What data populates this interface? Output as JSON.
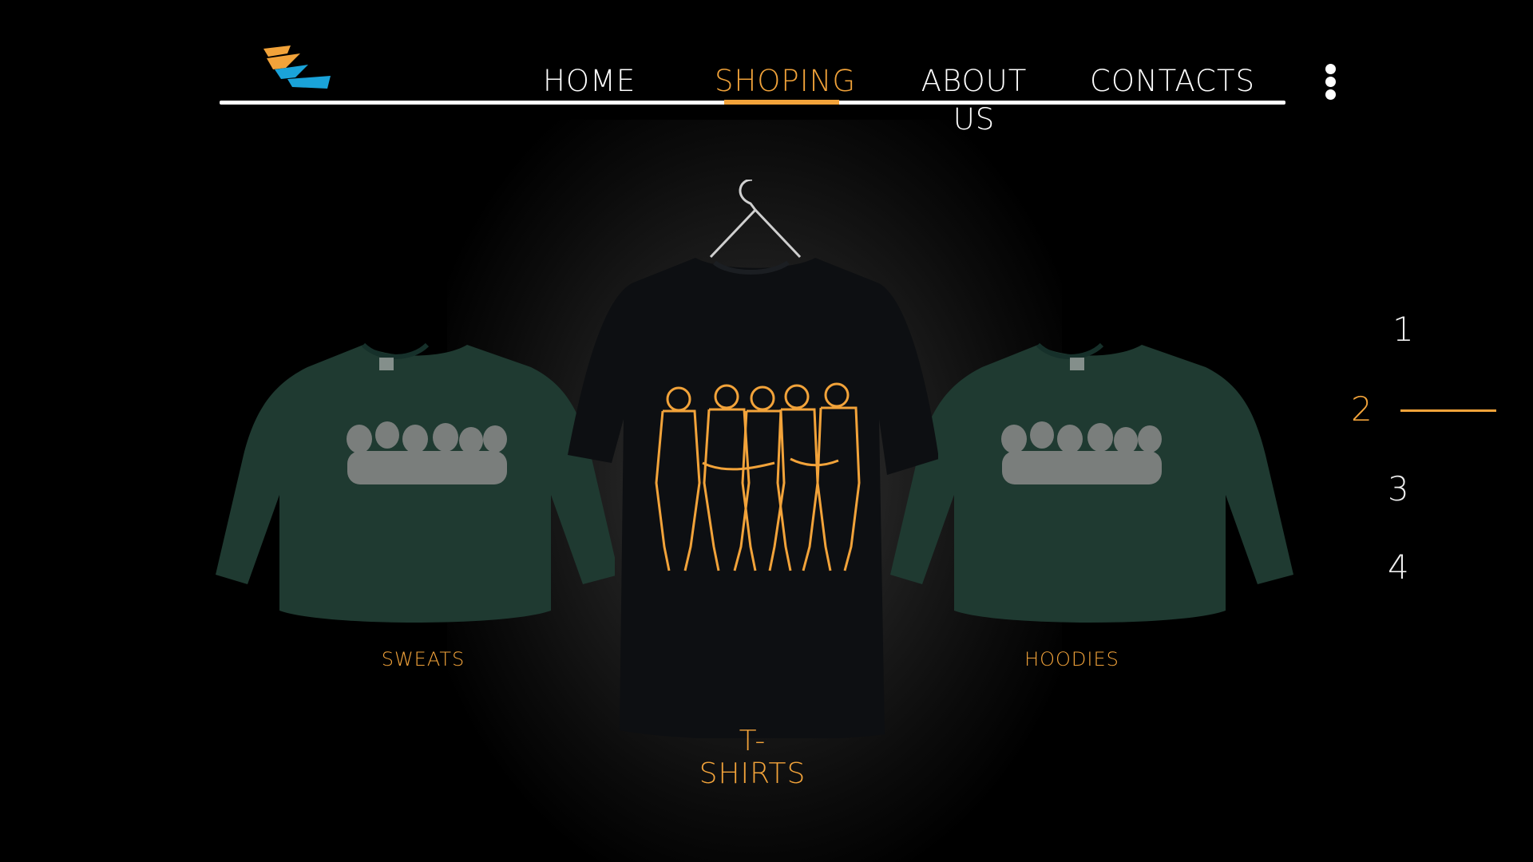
{
  "brand": {
    "logo_icon": "zigzag-logo-icon",
    "colors": {
      "orange": "#f2a33a",
      "blue": "#1aa3d9"
    }
  },
  "nav": {
    "items": [
      {
        "label": "HOME"
      },
      {
        "label": "SHOPING",
        "active": true
      },
      {
        "label": "ABOUT US"
      },
      {
        "label": "CONTACTS"
      }
    ],
    "menu_icon": "more-vertical-icon"
  },
  "products": {
    "left": {
      "label": "SWEATS",
      "color": "#1f3a31"
    },
    "center": {
      "label": "T-SHIRTS",
      "color": "#0d0f12",
      "print_color": "#f2a33a"
    },
    "right": {
      "label": "HOODIES",
      "color": "#1f3a31"
    }
  },
  "pager": {
    "pages": [
      "1",
      "2",
      "3",
      "4"
    ],
    "active": "2"
  }
}
